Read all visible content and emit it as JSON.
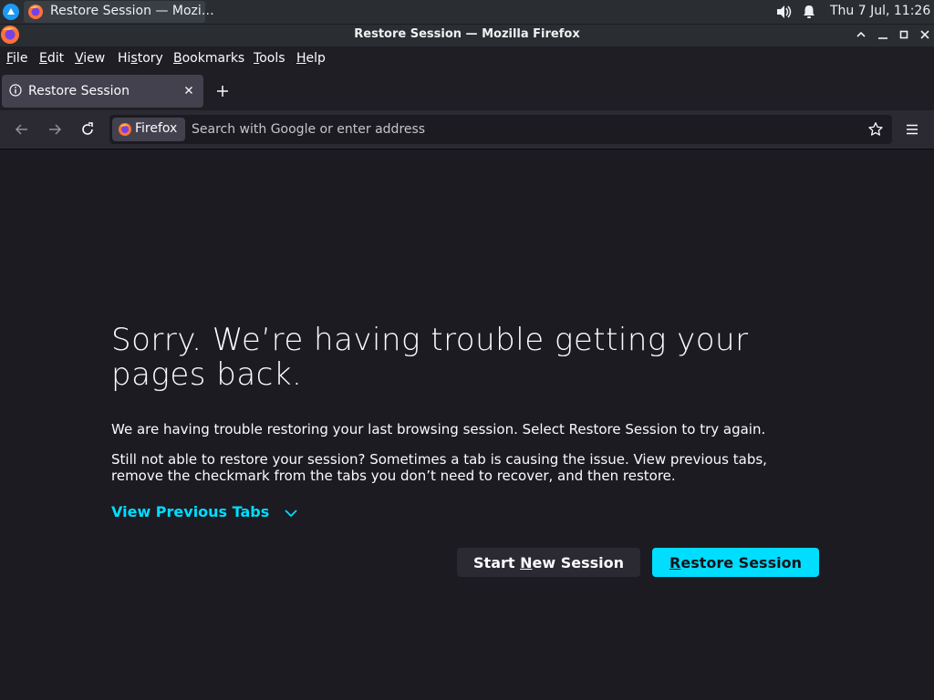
{
  "taskbar": {
    "task_label": "Restore Session — Mozi…",
    "clock": "Thu  7 Jul, 11:26"
  },
  "window": {
    "title": "Restore Session — Mozilla Firefox"
  },
  "menubar": {
    "items": [
      "File",
      "Edit",
      "View",
      "History",
      "Bookmarks",
      "Tools",
      "Help"
    ]
  },
  "tabs": [
    {
      "label": "Restore Session",
      "active": true
    }
  ],
  "navbar": {
    "identity_label": "Firefox",
    "url_placeholder": "Search with Google or enter address"
  },
  "page": {
    "heading": "Sorry. We’re having trouble getting your pages back.",
    "paragraph1": "We are having trouble restoring your last browsing session. Select Restore Session to try again.",
    "paragraph2": "Still not able to restore your session? Sometimes a tab is causing the issue. View previous tabs, remove the checkmark from the tabs you don’t need to recover, and then restore.",
    "view_previous_tabs": "View Previous Tabs",
    "start_new_session": {
      "before": "Start ",
      "accel": "N",
      "after": "ew Session"
    },
    "restore_session": {
      "before": "",
      "accel": "R",
      "after": "estore Session"
    }
  },
  "colors": {
    "accent": "#00ddff",
    "background": "#1c1b22",
    "toolbar": "#2b2a33"
  },
  "icons": [
    "kde-start-icon",
    "firefox-icon",
    "volume-icon",
    "bell-icon",
    "minimize-icon",
    "maximize-icon",
    "close-icon",
    "info-icon",
    "tab-close-icon",
    "new-tab-icon",
    "back-icon",
    "forward-icon",
    "reload-icon",
    "star-icon",
    "menu-icon",
    "chevron-down-icon"
  ]
}
